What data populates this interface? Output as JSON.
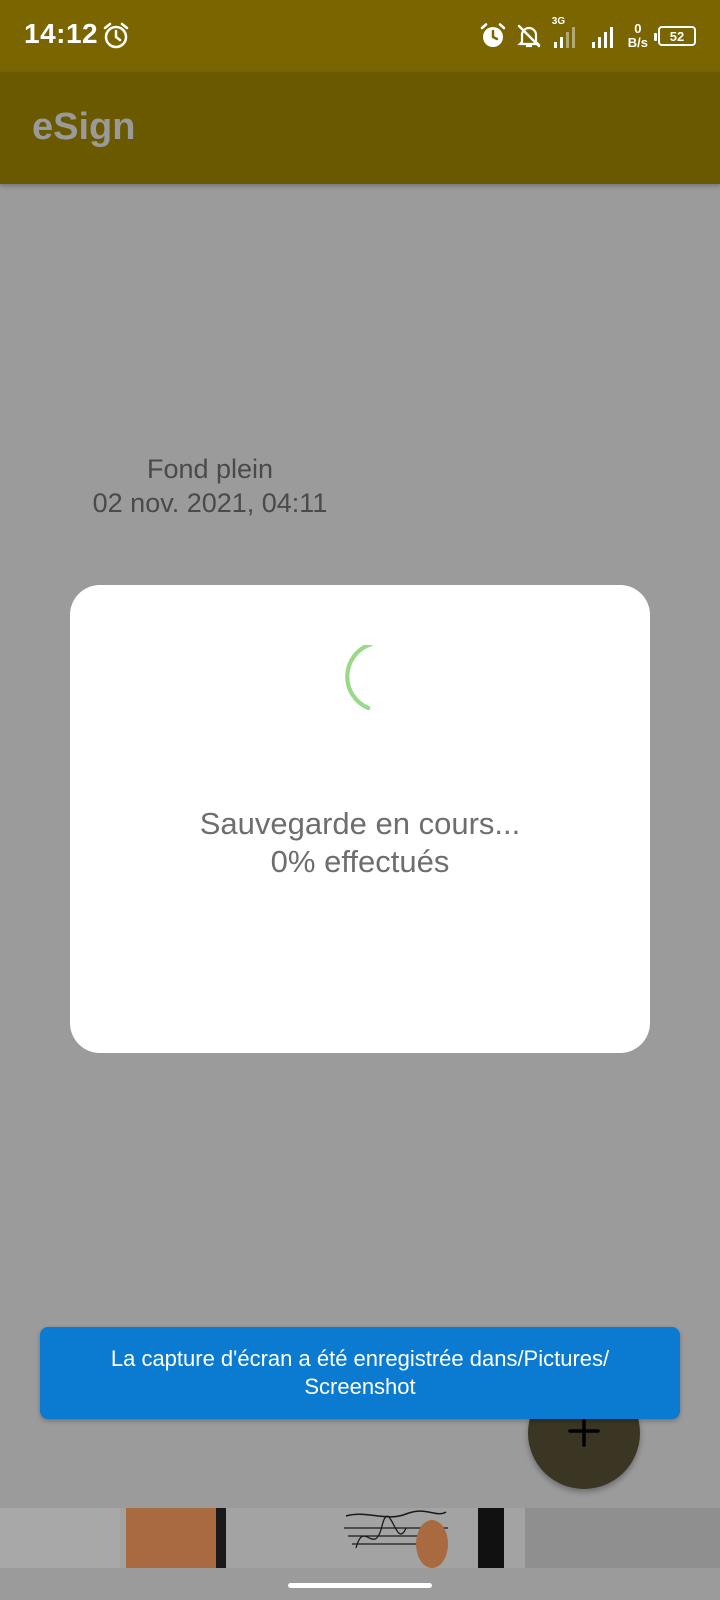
{
  "status_bar": {
    "time": "14:12",
    "network_type": "3G",
    "net_speed_value": "0",
    "net_speed_unit": "B/s",
    "battery": "52",
    "icons": [
      "alarm-icon",
      "alarm-icon",
      "bell-off-icon",
      "signal-icon",
      "signal-icon",
      "battery-icon"
    ]
  },
  "app_bar": {
    "title": "eSign"
  },
  "document": {
    "name": "Fond plein",
    "date": "02 nov. 2021, 04:11"
  },
  "dialog": {
    "status_text": "Sauvegarde en cours...",
    "progress_text": "0% effectués",
    "progress_percent": 0,
    "spinner_color": "#9ad98a"
  },
  "fab": {
    "icon": "plus-icon"
  },
  "toast": {
    "message": "La capture d'écran a été enregistrée dans/Pictures/ Screenshot",
    "color": "#0b7bd1"
  },
  "colors": {
    "status_bar": "#7a6500",
    "app_bar": "#6b5900",
    "scrim": "#9b9b9b"
  }
}
